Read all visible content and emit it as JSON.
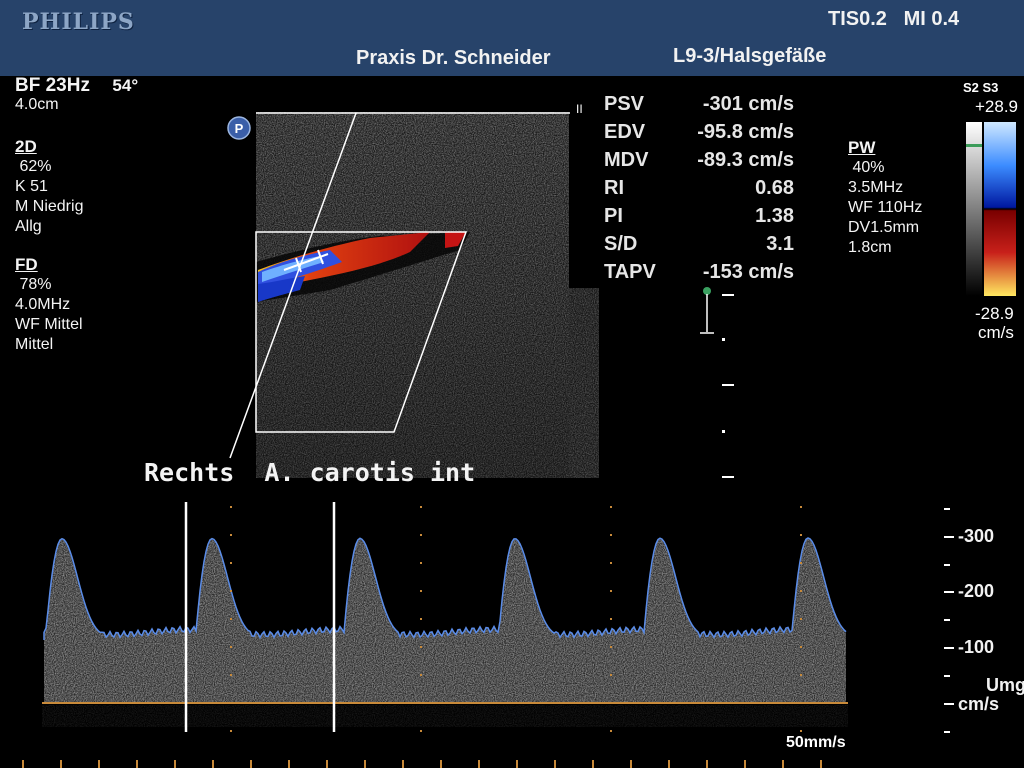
{
  "header": {
    "brand": "PHILIPS",
    "tis_mi": "TIS0.2   MI 0.4",
    "practice": "Praxis Dr. Schneider",
    "probe_preset": "L9-3/Halsgefäße"
  },
  "left_panel": {
    "bf": "BF 23Hz",
    "angle": "54°",
    "depth": "4.0cm",
    "mode_2d": {
      "title": "2D",
      "gain": " 62%",
      "k": "K 51",
      "m": "M Niedrig",
      "preset": "Allg"
    },
    "mode_fd": {
      "title": "FD",
      "gain": " 78%",
      "freq": "4.0MHz",
      "wf": "WF Mittel",
      "level": "Mittel"
    }
  },
  "pw_panel": {
    "title": "PW",
    "gain": " 40%",
    "freq": "3.5MHz",
    "wf": "WF 110Hz",
    "dv": "DV1.5mm",
    "depth": "1.8cm"
  },
  "color_bar": {
    "labels": "S2 S3",
    "max": "+28.9",
    "min": "-28.9",
    "unit": "cm/s"
  },
  "measurements": [
    {
      "name": "PSV",
      "value": "-301 cm/s"
    },
    {
      "name": "EDV",
      "value": "-95.8 cm/s"
    },
    {
      "name": "MDV",
      "value": "-89.3 cm/s"
    },
    {
      "name": "RI",
      "value": "0.68"
    },
    {
      "name": "PI",
      "value": "1.38"
    },
    {
      "name": "S/D",
      "value": "3.1"
    },
    {
      "name": "TAPV",
      "value": "-153 cm/s"
    }
  ],
  "caption": "Rechts  A. carotis int",
  "spectrum": {
    "scale_labels": [
      "-300",
      "-200",
      "-100"
    ],
    "umg": "Umg",
    "unit": "cm/s",
    "sweep_speed": "50mm/s"
  },
  "colors": {
    "header_bg": "#27436a",
    "baseline": "#c88a3a",
    "envelope": "#5a8ce8"
  }
}
